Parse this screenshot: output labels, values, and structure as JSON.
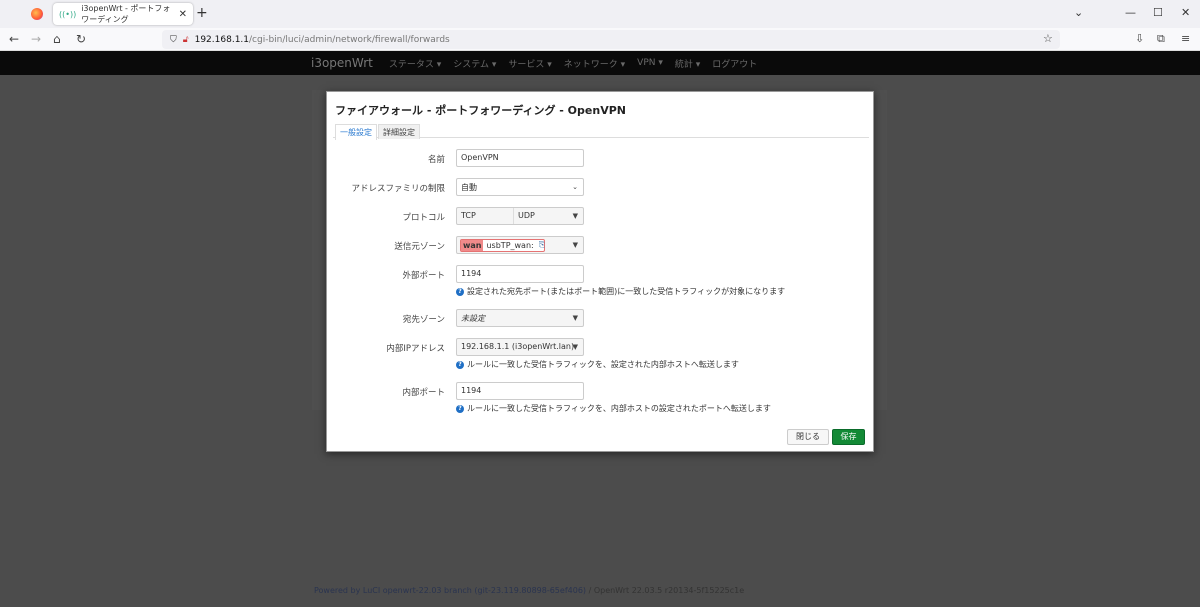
{
  "browser": {
    "tab_title": "i3openWrt - ポートフォワーディング",
    "url_host": "192.168.1.1",
    "url_path": "/cgi-bin/luci/admin/network/firewall/forwards"
  },
  "navbar": {
    "brand": "i3openWrt",
    "items": [
      "ステータス ▾",
      "システム ▾",
      "サービス ▾",
      "ネットワーク ▾",
      "VPN ▾",
      "統計 ▾",
      "ログアウト"
    ]
  },
  "modal": {
    "title": "ファイアウォール - ポートフォワーディング - OpenVPN",
    "tabs": [
      "一般設定",
      "詳細設定"
    ],
    "fields": {
      "name": {
        "label": "名前",
        "value": "OpenVPN"
      },
      "family": {
        "label": "アドレスファミリの制限",
        "value": "自動"
      },
      "protocol": {
        "label": "プロトコル",
        "values": [
          "TCP",
          "UDP"
        ]
      },
      "src_zone": {
        "label": "送信元ゾーン",
        "zone": "wan",
        "devices": "usbTP_wan:"
      },
      "ext_port": {
        "label": "外部ポート",
        "value": "1194",
        "help": "設定された宛先ポート(またはポート範囲)に一致した受信トラフィックが対象になります"
      },
      "dest_zone": {
        "label": "宛先ゾーン",
        "value": "未設定"
      },
      "int_ip": {
        "label": "内部IPアドレス",
        "value": "192.168.1.1 (i3openWrt.lan)",
        "help": "ルールに一致した受信トラフィックを、設定された内部ホストへ転送します"
      },
      "int_port": {
        "label": "内部ポート",
        "value": "1194",
        "help": "ルールに一致した受信トラフィックを、内部ホストの設定されたポートへ転送します"
      }
    },
    "close_label": "閉じる",
    "save_label": "保存"
  },
  "footer": {
    "powered": "Powered by LuCI openwrt-22.03 branch (git-23.119.80898-65ef406)",
    "version": " / OpenWrt 22.03.5 r20134-5f15225c1e"
  }
}
